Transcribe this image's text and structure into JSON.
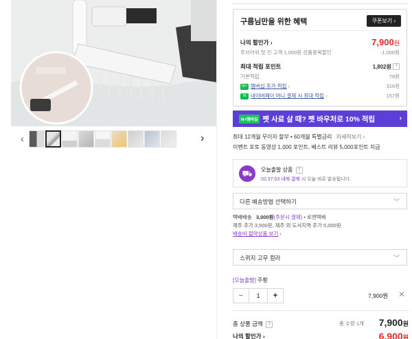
{
  "product_images": {
    "thumbnail_count": 9,
    "selected_thumbnail_index": 1
  },
  "coupon_box": {
    "title": "구름님만을 위한 혜택",
    "coupon_button": "쿠폰보기",
    "my_discount_label": "나의 할인가",
    "my_discount_price": "7,900",
    "won": "원",
    "first_purchase_label": "주브러쉬 첫 진 고객 1,000원 상품중복할인",
    "first_purchase_value": "-1,000원",
    "max_points_label": "최대 적립 포인트",
    "max_points_value": "1,802원",
    "base_points_label": "기본적립",
    "base_points_value": "79원",
    "membership_label": "멤버십 추가 적립",
    "membership_value": "316원",
    "npay_label": "네이버페이 머니 결제 시 최대 적립",
    "npay_value": "157원"
  },
  "banner": {
    "tag": "N+멤버십",
    "text": "펫 사료 살 때? 펫 바우처로 10% 적립"
  },
  "benefits": {
    "installment": "최대 12개월 무이자 할부 • 60개월 특별금리",
    "installment_more": "자세히보기",
    "events": "이벤트  포토 동영상 1,000 포인트, 베스트 리뷰 5,000포인트 지급"
  },
  "delivery": {
    "title": "오늘출발 상품",
    "sub_time": "02:37:03 내에 결제 시",
    "sub_rest": " 오늘 바로 발송됩니다."
  },
  "shipping_select": {
    "placeholder": "다른 배송방법 선택하기"
  },
  "shipping_info": {
    "line1_label": "택배배송",
    "line1_price": "3,000원",
    "line1_cond": "(주문시 결제)",
    "line1_carrier": " • 로젠택배",
    "line2": "제주 추가 3,500원, 제주 외 도서지역 추가 5,000원",
    "line3": "배송비 절약상품 보기"
  },
  "option_select": {
    "value": "스퀴지 고무 컬러"
  },
  "selected_option": {
    "tag": "[오늘출발]",
    "name": "주황",
    "quantity": "1",
    "minus": "−",
    "plus": "+",
    "price": "7,900원",
    "remove": "✕"
  },
  "totals": {
    "total_label": "총 상품 금액",
    "count_label": "총 수량 1개",
    "total_amount": "7,900",
    "my_discount_label": "나의 할인가",
    "my_discount_amount": "6,900",
    "won": "원"
  },
  "colors": {
    "accent_red": "#e02a2a",
    "banner_purple": "#5b3fd6",
    "today_purple": "#8a3cc6",
    "naver_green": "#0dbd4c"
  }
}
